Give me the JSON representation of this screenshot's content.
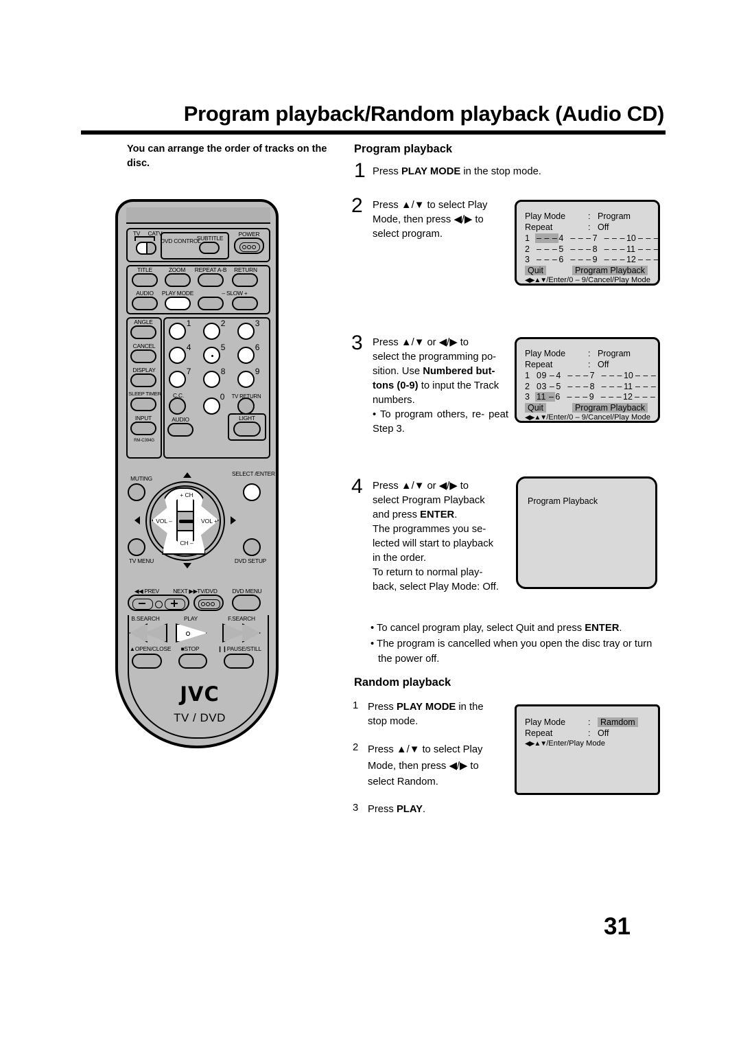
{
  "document": {
    "title": "Program playback/Random playback (Audio CD)",
    "page_number": "31",
    "lead_text": "You can arrange the order of tracks on the disc."
  },
  "sections": {
    "program": {
      "heading": "Program playback",
      "steps": [
        {
          "number": "1",
          "text_pre": "Press ",
          "text_bold": "PLAY MODE",
          "text_post": " in the stop mode."
        },
        {
          "number": "2",
          "line1": "Press ▲/▼ to select Play",
          "line2": "Mode, then press ◀/▶ to",
          "line3": "select program."
        },
        {
          "number": "3",
          "line1": "Press  ▲/▼  or  ◀/▶  to",
          "line2": "select the programming po-",
          "line3_pre": "sition. Use ",
          "line3_bold": "Numbered but-",
          "line4_bold": "tons (0-9)",
          "line4_post": " to input the Track",
          "line5": "numbers.",
          "bullet": "• To program others, re- peat Step 3."
        },
        {
          "number": "4",
          "line1": "Press  ▲/▼  or  ◀/▶  to",
          "line2": "select  Program  Playback",
          "line3_pre": "and  press  ",
          "line3_bold": "ENTER",
          "line3_post": ".",
          "line4": "The programmes you se-",
          "line5": "lected will start to playback",
          "line6": "in the order.",
          "line7": "To return to normal play-",
          "line8": "back, select Play Mode: Off."
        }
      ],
      "bullets": [
        "• To cancel program play, select Quit and press ENTER.",
        "• The program is cancelled when you open the disc tray or turn the power off."
      ],
      "bullet1_pre": "• To cancel program play, select Quit and press ",
      "bullet1_bold": "ENTER",
      "bullet1_post": ".",
      "bullet2": "• The program is cancelled when you open the disc tray or turn the power off."
    },
    "random": {
      "heading": "Random playback",
      "steps": [
        {
          "number": "1",
          "pre": "Press ",
          "bold": "PLAY MODE",
          "post": " in the stop mode."
        },
        {
          "number": "2",
          "line1": "Press ▲/▼ to select Play",
          "line2": "Mode, then press ◀/▶ to",
          "line3": "select Random."
        },
        {
          "number": "3",
          "pre": "Press ",
          "bold": "PLAY",
          "post": "."
        }
      ]
    }
  },
  "osd_screens": [
    {
      "id": "osd-step2",
      "play_mode_label": "Play Mode",
      "play_mode_value": "Program",
      "repeat_label": "Repeat",
      "repeat_value": "Off",
      "colon": ":",
      "tracks": [
        {
          "no": "1",
          "val": "– – –",
          "highlight": true
        },
        {
          "no": "4",
          "val": "– – –",
          "highlight": false
        },
        {
          "no": "7",
          "val": "– – –",
          "highlight": false
        },
        {
          "no": "10",
          "val": "– – –",
          "highlight": false
        },
        {
          "no": "2",
          "val": "– – –",
          "highlight": false
        },
        {
          "no": "5",
          "val": "– – –",
          "highlight": false
        },
        {
          "no": "8",
          "val": "– – –",
          "highlight": false
        },
        {
          "no": "11",
          "val": "– – –",
          "highlight": false
        },
        {
          "no": "3",
          "val": "– – –",
          "highlight": false
        },
        {
          "no": "6",
          "val": "– – –",
          "highlight": false
        },
        {
          "no": "9",
          "val": "– – –",
          "highlight": false
        },
        {
          "no": "12",
          "val": "– – –",
          "highlight": false
        }
      ],
      "quit_label": "Quit",
      "quit_highlight": true,
      "action_label": "Program Playback",
      "action_highlight": true,
      "footer_arrows": "◀▶▲▼",
      "footer_text": "/Enter/0 – 9/Cancel/Play Mode"
    },
    {
      "id": "osd-step3",
      "play_mode_label": "Play Mode",
      "play_mode_value": "Program",
      "repeat_label": "Repeat",
      "repeat_value": "Off",
      "colon": ":",
      "tracks": [
        {
          "no": "1",
          "val": "09 –",
          "highlight": false
        },
        {
          "no": "4",
          "val": "– – –",
          "highlight": false
        },
        {
          "no": "7",
          "val": "– – –",
          "highlight": false
        },
        {
          "no": "10",
          "val": "– – –",
          "highlight": false
        },
        {
          "no": "2",
          "val": "03 –",
          "highlight": false
        },
        {
          "no": "5",
          "val": "– – –",
          "highlight": false
        },
        {
          "no": "8",
          "val": "– – –",
          "highlight": false
        },
        {
          "no": "11",
          "val": "– – –",
          "highlight": false
        },
        {
          "no": "3",
          "val": "11 –",
          "highlight": true
        },
        {
          "no": "6",
          "val": "– – –",
          "highlight": false
        },
        {
          "no": "9",
          "val": "– – –",
          "highlight": false
        },
        {
          "no": "12",
          "val": "– – –",
          "highlight": false
        }
      ],
      "quit_label": "Quit",
      "quit_highlight": true,
      "action_label": "Program Playback",
      "action_highlight": true,
      "footer_arrows": "◀▶▲▼",
      "footer_text": "/Enter/0 – 9/Cancel/Play Mode"
    },
    {
      "id": "osd-step4",
      "message": "Program Playback"
    },
    {
      "id": "osd-random",
      "play_mode_label": "Play Mode",
      "play_mode_value": "Ramdom",
      "play_mode_highlight": true,
      "repeat_label": "Repeat",
      "repeat_value": "Off",
      "colon": ":",
      "footer_arrows": "◀▶▲▼",
      "footer_text": "/Enter/Play Mode"
    }
  ],
  "remote": {
    "brand": "JVC",
    "subtitle": "TV / DVD",
    "model": "RM-C394G",
    "labels": {
      "tv": "TV",
      "catv": "CATV",
      "dvd_control": "DVD CONTROL",
      "subtitle_btn": "SUBTITLE",
      "power": "POWER",
      "title": "TITLE",
      "zoom": "ZOOM",
      "repeat_ab": "REPEAT A-B",
      "return": "RETURN",
      "audio": "AUDIO",
      "play_mode": "PLAY MODE",
      "slow": "– SLOW +",
      "angle": "ANGLE",
      "cancel": "CANCEL",
      "display": "DISPLAY",
      "sleep_timer": "SLEEP TIMER",
      "cc": "C.C.",
      "tv_return": "TV RETURN",
      "input": "INPUT",
      "audio2": "AUDIO",
      "light": "LIGHT",
      "muting": "MUTING",
      "select_enter": "SELECT /ENTER",
      "tv_menu": "TV MENU",
      "dvd_setup": "DVD SETUP",
      "ch_plus": "+ CH",
      "ch_minus": "CH –",
      "vol_minus": "VOL –",
      "vol_plus": "VOL +",
      "prev": "PREV",
      "next": "NEXT",
      "tv_dvd": "TV/DVD",
      "dvd_menu": "DVD MENU",
      "b_search": "B.SEARCH",
      "play": "PLAY",
      "f_search": "F.SEARCH",
      "open_close": "OPEN/CLOSE",
      "stop": "STOP",
      "pause_still": "PAUSE/STILL"
    },
    "numbers": [
      "1",
      "2",
      "3",
      "4",
      "5",
      "6",
      "7",
      "8",
      "9",
      "0"
    ]
  }
}
